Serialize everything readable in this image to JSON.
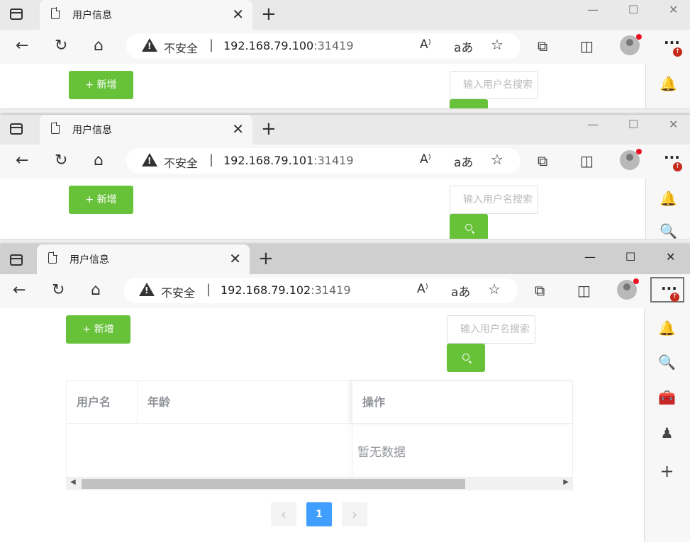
{
  "browser": {
    "tab_title": "用户信息",
    "insecure_label": "不安全",
    "separator": "|",
    "new_tab": "+",
    "close": "✕",
    "minimize": "—",
    "maximize": "☐",
    "more": "···",
    "more_badge": "↑"
  },
  "windows": [
    {
      "url_host": "192.168.79.100",
      "url_port": ":31419"
    },
    {
      "url_host": "192.168.79.101",
      "url_port": ":31419"
    },
    {
      "url_host": "192.168.79.102",
      "url_port": ":31419"
    }
  ],
  "page": {
    "add_button": "+ 新增",
    "search_placeholder": "输入用户名搜索",
    "table": {
      "columns": [
        "用户名",
        "年龄",
        "操作"
      ],
      "empty_text": "暂无数据"
    },
    "pagination": {
      "current_page": "1",
      "prev": "‹",
      "next": "›"
    }
  },
  "colors": {
    "accent_green": "#67c23a",
    "page_blue": "#409eff"
  },
  "sidebar_icons": [
    "bell-icon",
    "search-icon",
    "toolbox-icon",
    "chess-icon",
    "add-icon"
  ]
}
